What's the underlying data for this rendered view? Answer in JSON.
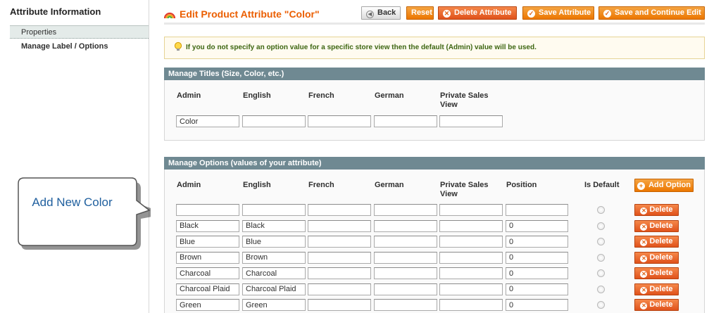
{
  "sidebar": {
    "title": "Attribute Information",
    "tabs": [
      {
        "label": "Properties"
      },
      {
        "label": "Manage Label / Options"
      }
    ]
  },
  "header": {
    "title": "Edit Product Attribute \"Color\"",
    "buttons": {
      "back": "Back",
      "reset": "Reset",
      "delete": "Delete Attribute",
      "save": "Save Attribute",
      "save_continue": "Save and Continue Edit"
    }
  },
  "notice": "If you do not specify an option value for a specific store view then the default (Admin) value will be used.",
  "titles_section": {
    "heading": "Manage Titles (Size, Color, etc.)",
    "columns": [
      "Admin",
      "English",
      "French",
      "German",
      "Private Sales View"
    ],
    "values": [
      "Color",
      "",
      "",
      "",
      ""
    ]
  },
  "options_section": {
    "heading": "Manage Options (values of your attribute)",
    "columns": [
      "Admin",
      "English",
      "French",
      "German",
      "Private Sales View",
      "Position",
      "Is Default"
    ],
    "add_label": "Add Option",
    "delete_label": "Delete",
    "rows": [
      {
        "admin": "",
        "english": "",
        "french": "",
        "german": "",
        "private": "",
        "position": ""
      },
      {
        "admin": "Black",
        "english": "Black",
        "french": "",
        "german": "",
        "private": "",
        "position": "0"
      },
      {
        "admin": "Blue",
        "english": "Blue",
        "french": "",
        "german": "",
        "private": "",
        "position": "0"
      },
      {
        "admin": "Brown",
        "english": "Brown",
        "french": "",
        "german": "",
        "private": "",
        "position": "0"
      },
      {
        "admin": "Charcoal",
        "english": "Charcoal",
        "french": "",
        "german": "",
        "private": "",
        "position": "0"
      },
      {
        "admin": "Charcoal Plaid",
        "english": "Charcoal Plaid",
        "french": "",
        "german": "",
        "private": "",
        "position": "0"
      },
      {
        "admin": "Green",
        "english": "Green",
        "french": "",
        "german": "",
        "private": "",
        "position": "0"
      }
    ]
  },
  "callout": {
    "text": "Add New Color"
  },
  "colors": {
    "accent": "#eb5e00",
    "section_header": "#6f8992",
    "delete": "#e0521b"
  }
}
